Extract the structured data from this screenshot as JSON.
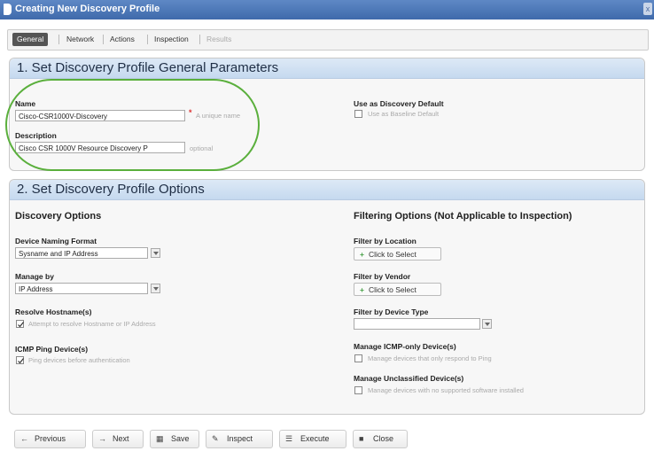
{
  "window": {
    "title": "Creating New Discovery Profile",
    "close_glyph": "x"
  },
  "tabs": [
    {
      "label": "General",
      "state": "active"
    },
    {
      "label": "Network",
      "state": "normal"
    },
    {
      "label": "Actions",
      "state": "normal"
    },
    {
      "label": "Inspection",
      "state": "normal"
    },
    {
      "label": "Results",
      "state": "disabled"
    }
  ],
  "general": {
    "title": "1. Set Discovery Profile General Parameters",
    "name_label": "Name",
    "name_value": "Cisco-CSR1000V-Discovery",
    "name_hint": "A unique name",
    "description_label": "Description",
    "description_value": "Cisco CSR 1000V Resource Discovery P",
    "description_hint": "optional",
    "default_label": "Use as Discovery Default",
    "default_check_label": "Use as Baseline Default",
    "default_checked": false
  },
  "options": {
    "title": "2. Set Discovery Profile Options",
    "discovery_heading": "Discovery Options",
    "naming_label": "Device Naming Format",
    "naming_value": "Sysname and IP Address",
    "manage_label": "Manage by",
    "manage_value": "IP Address",
    "resolve_label": "Resolve Hostname(s)",
    "resolve_check_label": "Attempt to resolve Hostname or IP Address",
    "resolve_checked": true,
    "ping_label": "ICMP Ping Device(s)",
    "ping_check_label": "Ping devices before authentication",
    "ping_checked": true,
    "filtering_heading": "Filtering Options (Not Applicable to Inspection)",
    "location_label": "Filter by Location",
    "location_button": "Click to Select",
    "vendor_label": "Filter by Vendor",
    "vendor_button": "Click to Select",
    "type_label": "Filter by Device Type",
    "type_value": "",
    "icmp_only_label": "Manage ICMP-only Device(s)",
    "icmp_only_check_label": "Manage devices that only respond to Ping",
    "icmp_only_checked": false,
    "unclassified_label": "Manage Unclassified Device(s)",
    "unclassified_check_label": "Manage devices with no supported software installed",
    "unclassified_checked": false
  },
  "footer": {
    "previous": {
      "icon": "arrow-left-icon",
      "label": "Previous"
    },
    "next": {
      "icon": "arrow-right-icon",
      "label": "Next"
    },
    "save": {
      "icon": "save-icon",
      "label": "Save"
    },
    "inspect": {
      "icon": "pencil-icon",
      "label": "Inspect"
    },
    "execute": {
      "icon": "execute-icon",
      "label": "Execute"
    },
    "close": {
      "icon": "close-square-icon",
      "label": "Close"
    }
  },
  "colors": {
    "titlebar": "#4a76b8",
    "highlight_oval": "#5aaf3c",
    "panel_header": "#cfdff1"
  }
}
